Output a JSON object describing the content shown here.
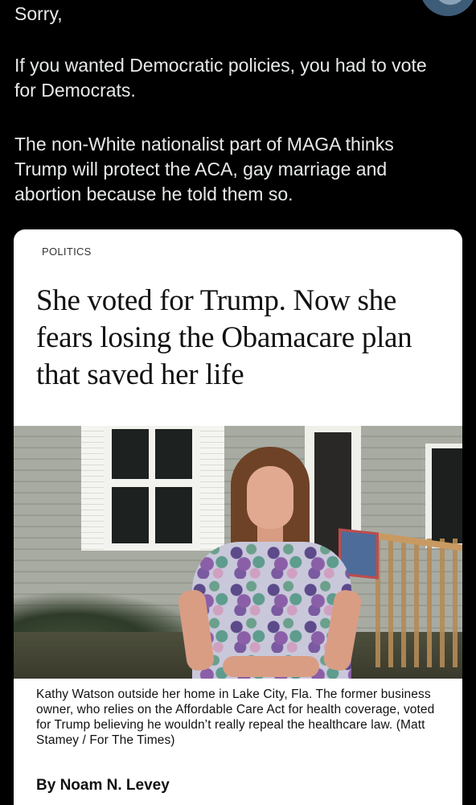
{
  "tweet": {
    "paragraphs": [
      "Sorry,",
      "If you wanted Democratic policies, you had to vote for Democrats.",
      "The non-White nationalist part of MAGA thinks Trump will protect the ACA, gay marriage and abortion because he told them so."
    ]
  },
  "link_card": {
    "section": "POLITICS",
    "headline": "She voted for Trump. Now she fears losing the Obamacare plan that saved her life",
    "caption": "Kathy Watson outside her home in Lake City, Fla. The former business owner, who relies on the Affordable Care Act for health coverage, voted for Trump believing he wouldn’t really repeal the healthcare law.  (Matt Stamey / For The Times)",
    "byline": "By Noam N. Levey"
  }
}
